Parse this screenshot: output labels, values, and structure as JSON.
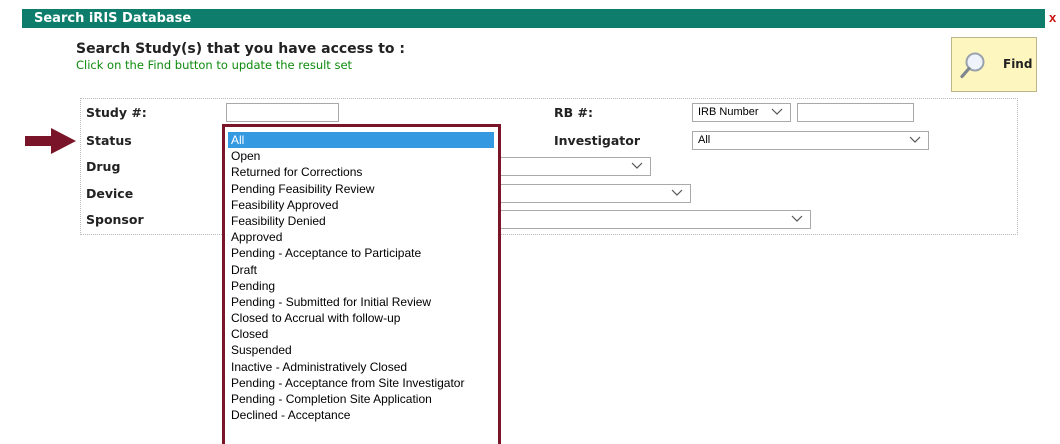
{
  "window": {
    "title": "Search iRIS Database",
    "close_label": "x"
  },
  "header": {
    "heading": "Search Study(s) that you have access to :",
    "subheading": "Click on the Find button to update the result set"
  },
  "find_button": {
    "label": "Find",
    "icon": "magnifier-icon"
  },
  "form": {
    "study_label": "Study #:",
    "study_value": "",
    "status_label": "Status",
    "drug_label": "Drug",
    "device_label": "Device",
    "sponsor_label": "Sponsor",
    "rb_label": "RB #:",
    "rb_type_value": "IRB Number",
    "rb_value": "",
    "investigator_label": "Investigator",
    "investigator_value": "All"
  },
  "status_dropdown": {
    "selected": "All",
    "options": [
      "All",
      "Open",
      "Returned for Corrections",
      "Pending Feasibility Review",
      "Feasibility Approved",
      "Feasibility Denied",
      "Approved",
      "Pending - Acceptance to Participate",
      "Draft",
      "Pending",
      "Pending - Submitted for Initial Review",
      "Closed to Accrual with follow-up",
      "Closed",
      "Suspended",
      "Inactive - Administratively Closed",
      "Pending - Acceptance from Site Investigator",
      "Pending - Completion Site Application",
      "Declined - Acceptance"
    ]
  },
  "colors": {
    "titlebar": "#0e7d6c",
    "highlight_border": "#7a1428",
    "selected_option": "#3399e0",
    "subheading": "#0d8a0d",
    "find_button_bg": "#fdf6bf",
    "close": "#cc1010"
  }
}
